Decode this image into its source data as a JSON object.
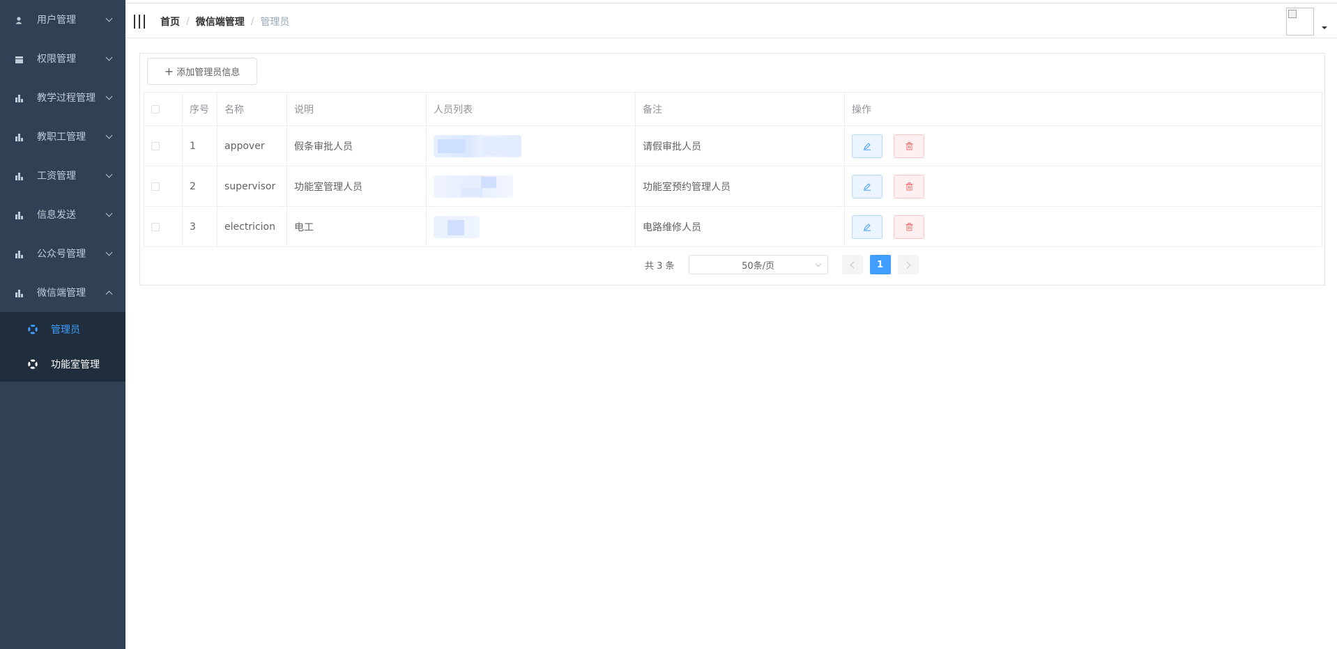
{
  "sidebar": {
    "items": [
      {
        "label": "用户管理",
        "icon": "user-icon"
      },
      {
        "label": "权限管理",
        "icon": "table-icon"
      },
      {
        "label": "教学过程管理",
        "icon": "chart-icon"
      },
      {
        "label": "教职工管理",
        "icon": "chart-icon"
      },
      {
        "label": "工资管理",
        "icon": "chart-icon"
      },
      {
        "label": "信息发送",
        "icon": "chart-icon"
      },
      {
        "label": "公众号管理",
        "icon": "chart-icon"
      },
      {
        "label": "微信端管理",
        "icon": "chart-icon",
        "expanded": true
      }
    ],
    "submenu": [
      {
        "label": "管理员",
        "active": true
      },
      {
        "label": "功能室管理",
        "active": false
      }
    ],
    "colors": {
      "background": "#304156",
      "submenu_background": "#1f2d3d",
      "active": "#409eff"
    }
  },
  "breadcrumb": {
    "items": [
      "首页",
      "微信端管理",
      "管理员"
    ],
    "separator": "/"
  },
  "toolbar": {
    "add_label": "添加管理员信息"
  },
  "table": {
    "headers": [
      "序号",
      "名称",
      "说明",
      "人员列表",
      "备注",
      "操作"
    ],
    "rows": [
      {
        "index": "1",
        "name": "appover",
        "desc": "假条审批人员",
        "remark": "请假审批人员"
      },
      {
        "index": "2",
        "name": "supervisor",
        "desc": "功能室管理人员",
        "remark": "功能室预约管理人员"
      },
      {
        "index": "3",
        "name": "electricion",
        "desc": "电工",
        "remark": "电路维修人员"
      }
    ]
  },
  "pagination": {
    "total": "共 3 条",
    "page_size": "50条/页",
    "current_page": "1"
  },
  "colors": {
    "primary": "#409eff",
    "danger": "#f56c6c"
  }
}
